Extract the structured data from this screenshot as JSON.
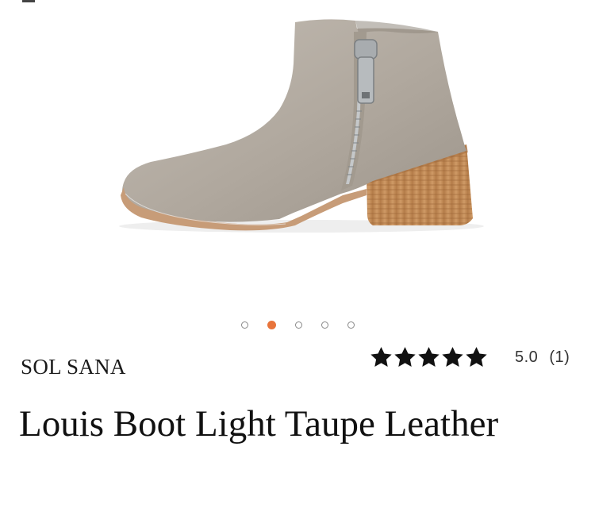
{
  "gallery": {
    "image_alt": "Louis Boot Light Taupe Leather ankle boot",
    "slide_count": 5,
    "active_slide": 2,
    "colors": {
      "leather": "#b3aba1",
      "heel_wood": "#c08a57",
      "sole": "#c79c78",
      "zipper": "#9ea2a4"
    }
  },
  "product": {
    "brand": "SOL SANA",
    "name": "Louis Boot Light Taupe Leather",
    "rating": {
      "stars": 5,
      "score": "5.0",
      "count": "(1)"
    }
  },
  "colors": {
    "accent_dot": "#e8743b",
    "star": "#111111"
  }
}
